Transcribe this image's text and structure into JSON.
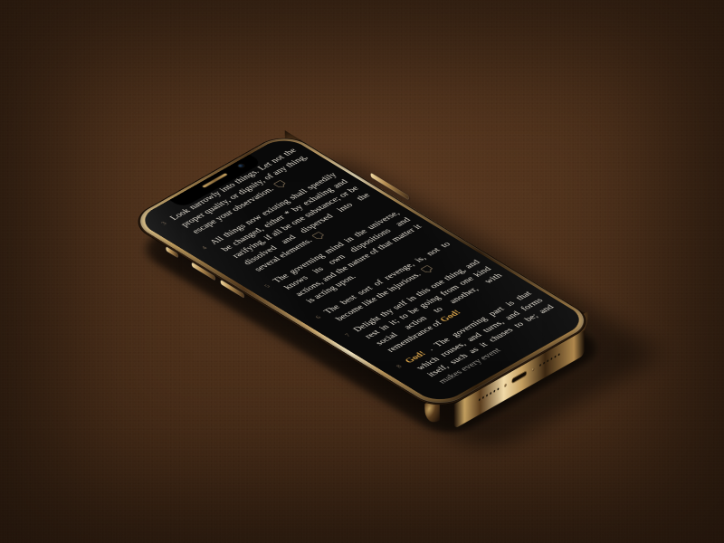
{
  "device": {
    "model_label": "Gold smartphone mockup",
    "speaker": "earpiece",
    "camera": "front-camera"
  },
  "reader": {
    "theme": "dark",
    "accent_hex": "#d7a24a",
    "text_hex": "#e8e2d6",
    "highlight_word": "God!",
    "entries": [
      {
        "n": "3",
        "text": "Look narrowly into things. Let not the proper quality, or dignity, of any thing, escape your observation.",
        "has_note": true
      },
      {
        "n": "4",
        "text": "All things now existing shall speedily be changed, either * by exhaling and rarifying, if all be one substance; or be dissolved and dispersed into the several elements.",
        "has_note": true
      },
      {
        "n": "5",
        "text": "The governing mind in the universe, knows its own dispositions and actions, and the nature of that matter it is acting upon.",
        "has_note": false
      },
      {
        "n": "6",
        "text": "The best sort of revenge, is, not to become like the injurious.",
        "has_note": true
      },
      {
        "n": "7",
        "text": "Delight thy self in this one thing, and rest in it; to be going from one kind social action to another, with remembrance of",
        "has_note": false
      },
      {
        "n": "8",
        "text": " . The governing part is that which rouses, and turns, and forms itself, such as it chuses to be; and makes every event",
        "has_note": false
      }
    ]
  }
}
